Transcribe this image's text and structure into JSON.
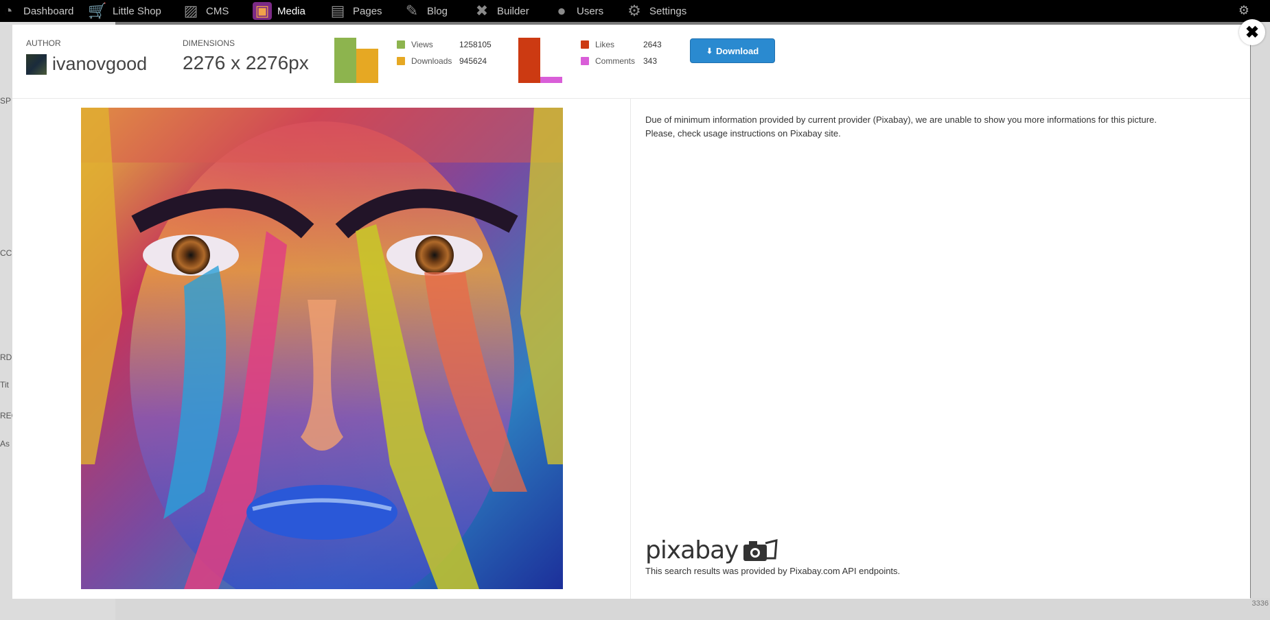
{
  "nav": {
    "items": [
      {
        "label": "Dashboard",
        "icon": "dashboard-icon",
        "glyph": "◔"
      },
      {
        "label": "Little Shop",
        "icon": "cart-icon",
        "glyph": "🛒"
      },
      {
        "label": "CMS",
        "icon": "cms-icon",
        "glyph": "▨"
      },
      {
        "label": "Media",
        "icon": "media-icon",
        "glyph": "▣"
      },
      {
        "label": "Pages",
        "icon": "pages-icon",
        "glyph": "▤"
      },
      {
        "label": "Blog",
        "icon": "blog-icon",
        "glyph": "✎"
      },
      {
        "label": "Builder",
        "icon": "builder-icon",
        "glyph": "✖"
      },
      {
        "label": "Users",
        "icon": "users-icon",
        "glyph": "●"
      },
      {
        "label": "Settings",
        "icon": "settings-icon",
        "glyph": "⚙"
      }
    ],
    "active": "Media"
  },
  "modal": {
    "author_label": "AUTHOR",
    "author_name": "ivanovgood",
    "dimensions_label": "DIMENSIONS",
    "dimensions_value": "2276 x 2276px",
    "stats_primary": [
      {
        "name": "Views",
        "value": "1258105",
        "number": 1258105,
        "color": "#8db44e"
      },
      {
        "name": "Downloads",
        "value": "945624",
        "number": 945624,
        "color": "#e6a823"
      }
    ],
    "stats_secondary": [
      {
        "name": "Likes",
        "value": "2643",
        "number": 2643,
        "color": "#cc3a12"
      },
      {
        "name": "Comments",
        "value": "343",
        "number": 343,
        "color": "#d95ed8"
      }
    ],
    "download_label": "Download",
    "close_glyph": "✖",
    "info_line1": "Due of minimum information provided by current provider (Pixabay), we are unable to show you more informations for this picture.",
    "info_line2": "Please, check usage instructions on Pixabay site.",
    "logo_text": "pixabay",
    "credit": "This search results was provided by Pixabay.com API endpoints."
  },
  "background": {
    "sidebar_fragments": [
      "SP",
      "CC",
      "RDI",
      "Tit",
      "REG",
      "As"
    ],
    "footer_fragment": "3336"
  }
}
